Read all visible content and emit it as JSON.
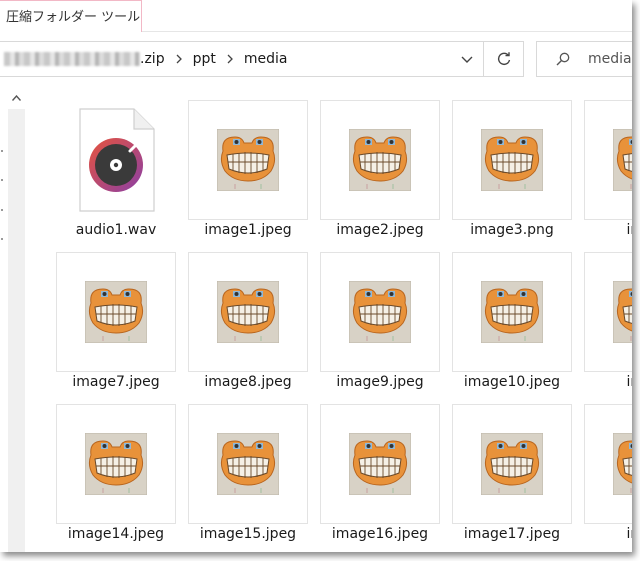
{
  "ribbon": {
    "tab_label": "圧縮フォルダー ツール"
  },
  "address": {
    "segments": [
      ".zip",
      "ppt",
      "media"
    ],
    "blurred_prefix": true
  },
  "search": {
    "placeholder": "media"
  },
  "icons": {
    "address_dropdown": "chevron-down-icon",
    "refresh": "refresh-icon",
    "search": "search-icon",
    "scroll_up": "scroll-up-arrow-icon",
    "audio_file": "audio-file-icon"
  },
  "files": [
    [
      "audio1.wav",
      "image1.jpeg",
      "image2.jpeg",
      "image3.png",
      "imag"
    ],
    [
      "image7.jpeg",
      "image8.jpeg",
      "image9.jpeg",
      "image10.jpeg",
      "imag"
    ],
    [
      "image14.jpeg",
      "image15.jpeg",
      "image16.jpeg",
      "image17.jpeg",
      "imag"
    ]
  ],
  "colors": {
    "ribbon_tab_border": "#f2b8c6",
    "frog_orange": "#e8923a",
    "thumb_bg": "#d8d2c6",
    "audio_gradient": [
      "#e6543d",
      "#8b3fa5"
    ]
  }
}
